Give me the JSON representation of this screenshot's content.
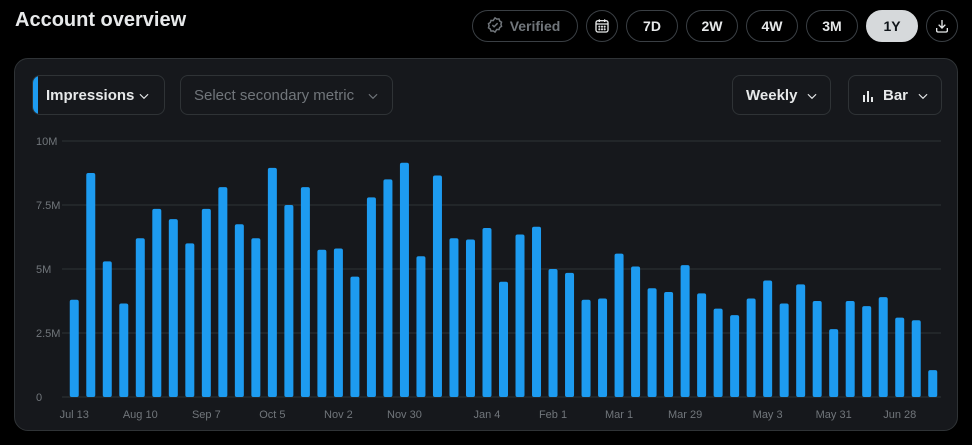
{
  "header": {
    "title": "Account overview"
  },
  "range": {
    "verified_label": "Verified",
    "periods": [
      "7D",
      "2W",
      "4W",
      "3M",
      "1Y"
    ],
    "active_period": "1Y"
  },
  "controls": {
    "primary_metric": "Impressions",
    "secondary_placeholder": "Select secondary metric",
    "interval": "Weekly",
    "chart_type": "Bar"
  },
  "colors": {
    "bar": "#1d9bf0",
    "accent": "#1d9bf0",
    "grid": "#2f3336"
  },
  "chart_data": {
    "type": "bar",
    "series": [
      {
        "values": [
          3.8,
          8.75,
          5.3,
          3.65,
          6.2,
          7.35,
          6.95,
          6.0,
          7.35,
          8.2,
          6.75,
          6.2,
          8.95,
          7.5,
          8.2,
          5.75,
          5.8,
          4.7,
          7.8,
          8.5,
          9.15,
          5.5,
          8.65,
          6.2,
          6.15,
          6.6,
          4.5,
          6.35,
          6.65,
          5.0,
          4.85,
          3.8,
          3.85,
          5.6,
          5.1,
          4.25,
          4.1,
          5.15,
          4.05,
          3.45,
          3.2,
          3.85,
          4.55,
          3.65,
          4.4,
          3.75,
          2.65,
          3.75,
          3.55,
          3.9,
          3.1,
          3.0,
          1.05
        ]
      }
    ],
    "unit": "M",
    "ylim": [
      0,
      10
    ],
    "yticks": [
      0,
      2.5,
      5,
      7.5,
      10
    ],
    "ytick_labels": [
      "0",
      "2.5M",
      "5M",
      "7.5M",
      "10M"
    ],
    "xtick_labels": [
      "Jul 13",
      "Aug 10",
      "Sep 7",
      "Oct 5",
      "Nov 2",
      "Nov 30",
      "Jan 4",
      "Feb 1",
      "Mar 1",
      "Mar 29",
      "May 3",
      "May 31",
      "Jun 28"
    ],
    "xtick_bar_index": [
      0,
      4,
      8,
      12,
      16,
      20,
      25,
      29,
      33,
      37,
      42,
      46,
      50
    ],
    "grid": true
  }
}
